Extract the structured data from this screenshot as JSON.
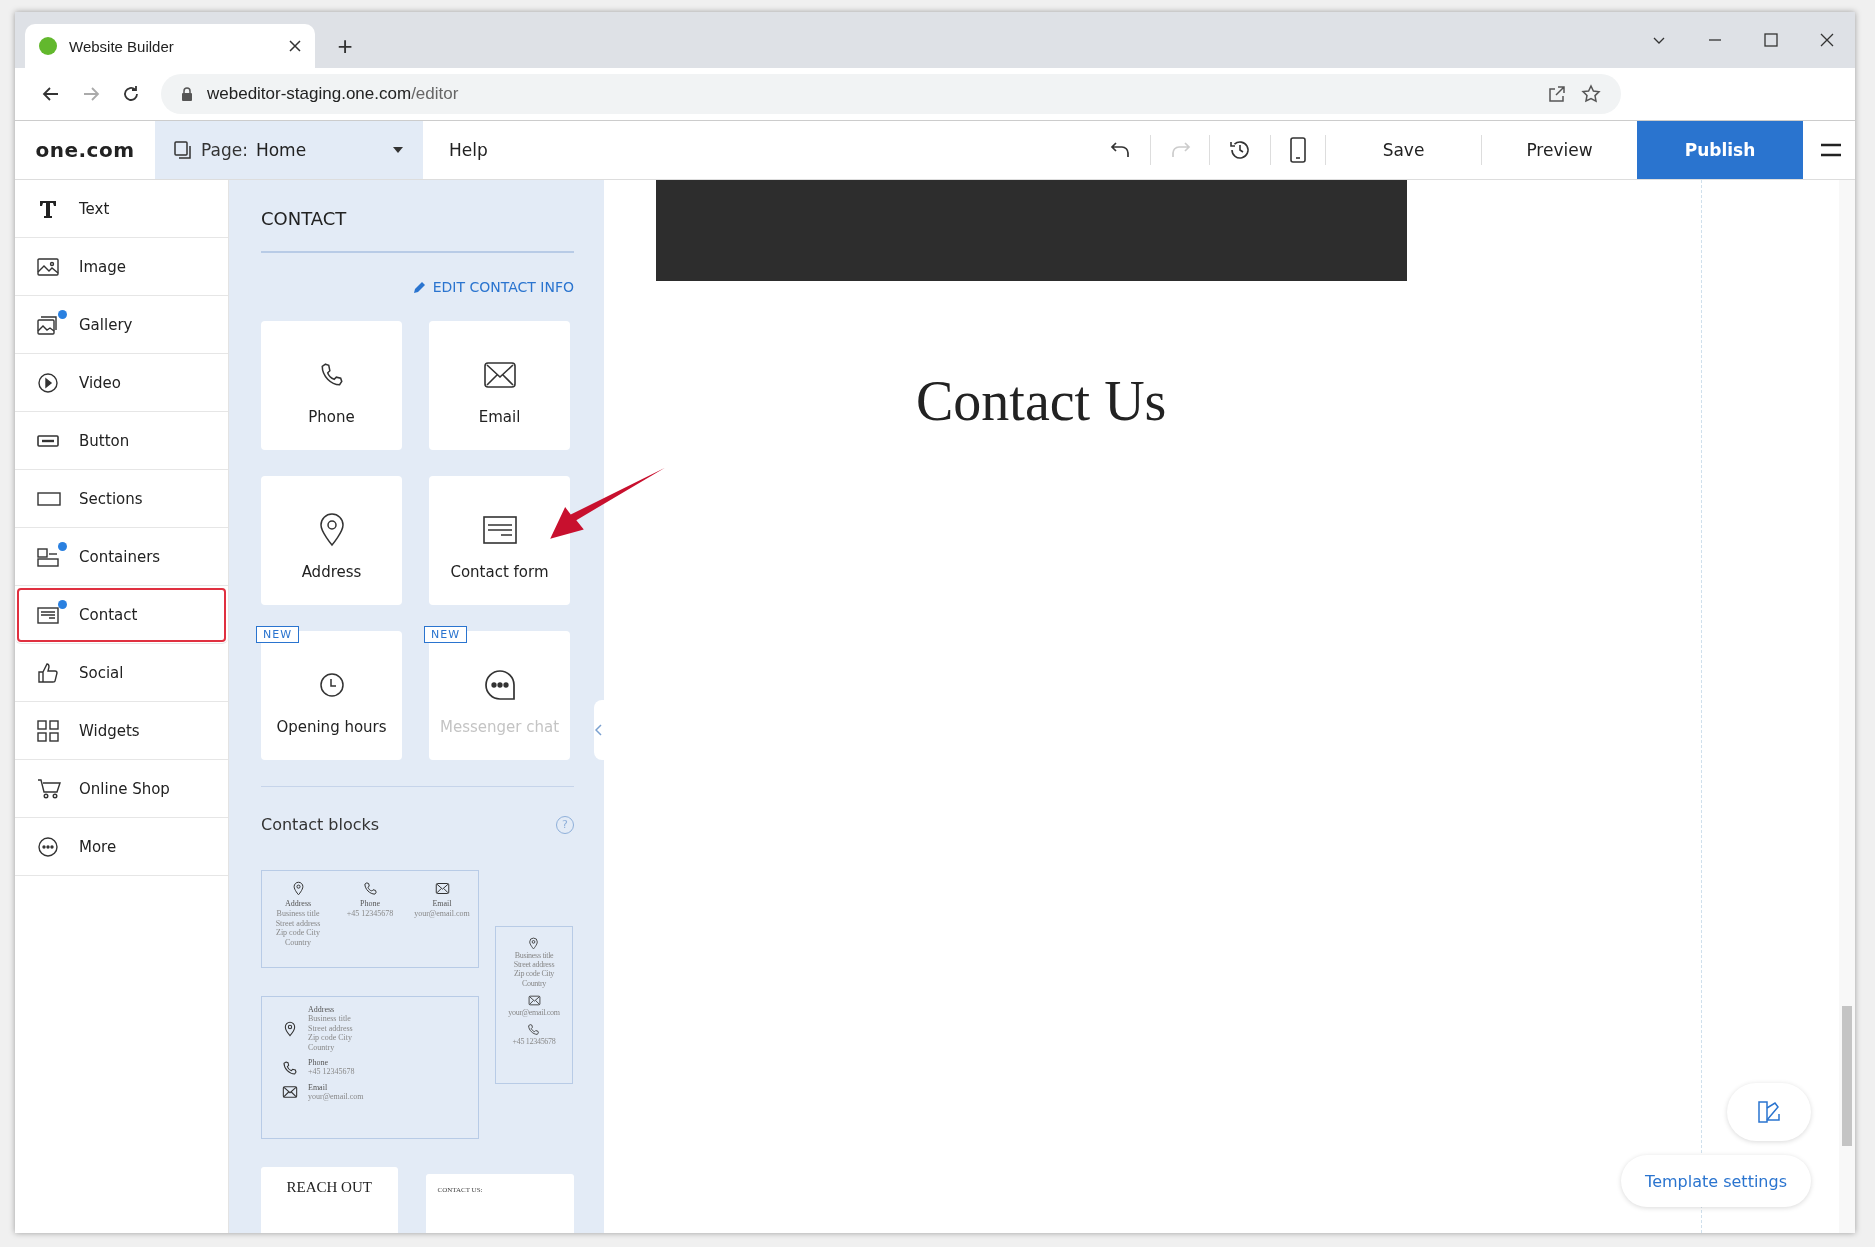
{
  "browser": {
    "tab_title": "Website Builder",
    "new_tab": "+",
    "url_host": "webeditor-staging.one.com",
    "url_path": "/editor"
  },
  "editor_toolbar": {
    "logo": "one.com",
    "page_label": "Page:",
    "page_name": "Home",
    "help": "Help",
    "save": "Save",
    "preview": "Preview",
    "publish": "Publish"
  },
  "sidebar": {
    "items": [
      {
        "kind": "text",
        "label": "Text",
        "dot": false,
        "selected": false
      },
      {
        "kind": "image",
        "label": "Image",
        "dot": false,
        "selected": false
      },
      {
        "kind": "gallery",
        "label": "Gallery",
        "dot": true,
        "selected": false
      },
      {
        "kind": "video",
        "label": "Video",
        "dot": false,
        "selected": false
      },
      {
        "kind": "button",
        "label": "Button",
        "dot": false,
        "selected": false
      },
      {
        "kind": "sections",
        "label": "Sections",
        "dot": false,
        "selected": false
      },
      {
        "kind": "containers",
        "label": "Containers",
        "dot": true,
        "selected": false
      },
      {
        "kind": "contact",
        "label": "Contact",
        "dot": true,
        "selected": true
      },
      {
        "kind": "social",
        "label": "Social",
        "dot": false,
        "selected": false
      },
      {
        "kind": "widgets",
        "label": "Widgets",
        "dot": false,
        "selected": false
      },
      {
        "kind": "shop",
        "label": "Online Shop",
        "dot": false,
        "selected": false
      },
      {
        "kind": "more",
        "label": "More",
        "dot": false,
        "selected": false
      }
    ]
  },
  "panel": {
    "title": "CONTACT",
    "edit_link": "EDIT CONTACT INFO",
    "tiles": [
      {
        "kind": "phone",
        "label": "Phone",
        "disabled": false
      },
      {
        "kind": "email",
        "label": "Email",
        "disabled": false
      },
      {
        "kind": "address",
        "label": "Address",
        "disabled": false
      },
      {
        "kind": "form",
        "label": "Contact form",
        "disabled": false
      },
      {
        "kind": "hours",
        "label": "Opening hours",
        "badge": "NEW",
        "disabled": false
      },
      {
        "kind": "chat",
        "label": "Messenger chat",
        "badge": "NEW",
        "disabled": true
      }
    ],
    "blocks_title": "Contact blocks",
    "help": "?",
    "block_row": [
      {
        "kind": "pin",
        "title": "Address",
        "lines": [
          "Business title",
          "Street address",
          "Zip code City",
          "Country"
        ]
      },
      {
        "kind": "phone",
        "title": "Phone",
        "lines": [
          "+45 12345678"
        ]
      },
      {
        "kind": "mail",
        "title": "Email",
        "lines": [
          "your@email.com"
        ]
      }
    ],
    "block_column": [
      {
        "kind": "pin",
        "lines": [
          "Business title",
          "Street address",
          "Zip code City",
          "Country"
        ]
      },
      {
        "kind": "mail",
        "lines": [
          "your@email.com"
        ]
      },
      {
        "kind": "phone",
        "lines": [
          "+45 12345678"
        ]
      }
    ],
    "block_list": [
      {
        "kind": "pin",
        "title": "Address",
        "lines": [
          "Business title",
          "Street address",
          "Zip code City",
          "Country"
        ]
      },
      {
        "kind": "phone",
        "title": "Phone",
        "lines": [
          "+45 12345678"
        ]
      },
      {
        "kind": "mail",
        "title": "Email",
        "lines": [
          "your@email.com"
        ]
      }
    ],
    "block_heading": "REACH OUT",
    "block_caption": "CONTACT US:"
  },
  "canvas": {
    "heading": "Contact Us",
    "template_settings": "Template settings"
  }
}
